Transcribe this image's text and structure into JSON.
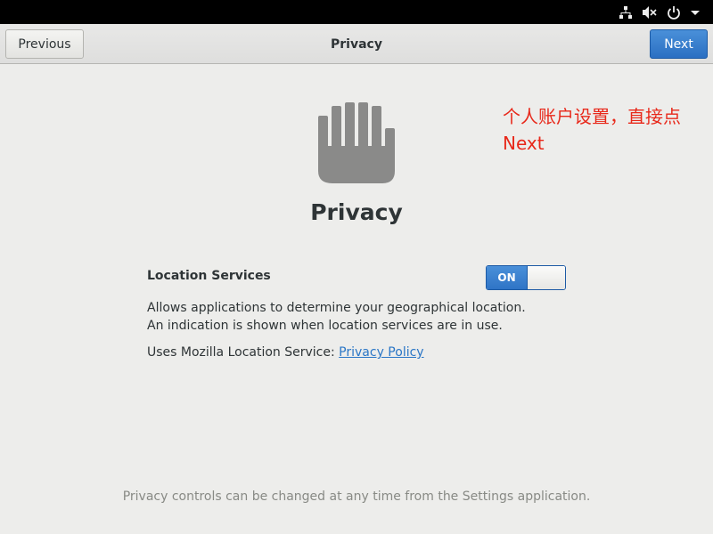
{
  "header": {
    "previous_label": "Previous",
    "title": "Privacy",
    "next_label": "Next"
  },
  "annotation": {
    "line1": "个人账户设置，直接点",
    "line2": "Next"
  },
  "page": {
    "title": "Privacy",
    "icon": "hand-stop-icon"
  },
  "location": {
    "label": "Location Services",
    "switch_state": "ON",
    "description": "Allows applications to determine your geographical location. An indication is shown when location services are in use.",
    "uses_prefix": "Uses Mozilla Location Service: ",
    "policy_link": "Privacy Policy"
  },
  "footer": {
    "note": "Privacy controls can be changed at any time from the Settings application."
  },
  "status_icons": [
    "network-icon",
    "volume-muted-icon",
    "power-icon",
    "dropdown-arrow-icon"
  ],
  "colors": {
    "accent": "#2f74c6",
    "annotation": "#e8281a",
    "link": "#2a76c6"
  }
}
